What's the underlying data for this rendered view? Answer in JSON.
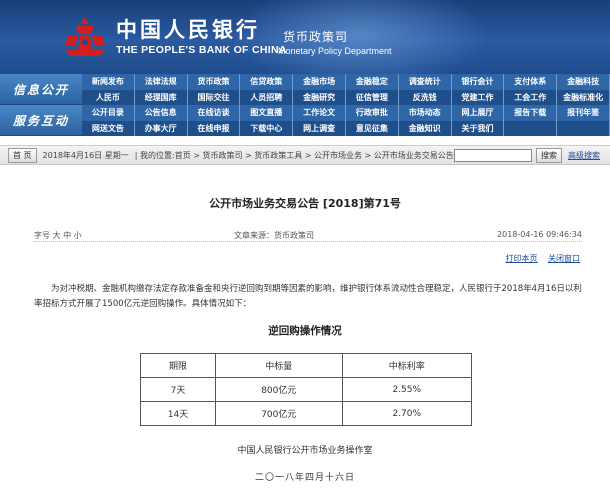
{
  "header": {
    "brand_cn": "中国人民银行",
    "brand_en": "THE PEOPLE'S BANK OF CHINA",
    "dept_cn": "货币政策司",
    "dept_en": "Monetary Policy Department"
  },
  "nav": {
    "rows": [
      {
        "side": "信息公开",
        "items": [
          "新闻发布",
          "法律法规",
          "货币政策",
          "信贷政策",
          "金融市场",
          "金融稳定",
          "调查统计",
          "银行会计",
          "支付体系",
          "金融科技",
          "人民币",
          "经理国库",
          "国际交往",
          "人员招聘",
          "金融研究",
          "征信管理",
          "反洗钱",
          "党建工作",
          "工会工作",
          "金融标准化"
        ]
      },
      {
        "side": "服务互动",
        "items": [
          "公开目录",
          "公告信息",
          "在线访谈",
          "图文直播",
          "工作论文",
          "行政审批",
          "市场动态",
          "网上展厅",
          "报告下载",
          "报刊年鉴",
          "网送文告",
          "办事大厅",
          "在线申报",
          "下载中心",
          "网上调查",
          "意见征集",
          "金融知识",
          "关于我们",
          "",
          ""
        ]
      }
    ]
  },
  "crumbbar": {
    "home_button": "首 页",
    "date": "2018年4月16日 星期一",
    "path": "| 我的位置:首页 > 货币政策司 > 货币政策工具 > 公开市场业务 > 公开市场业务交易公告",
    "search_button": "搜索",
    "advanced_search": "高级搜索"
  },
  "article": {
    "title": "公开市场业务交易公告 [2018]第71号",
    "font_size_label": "字号 大 中 小",
    "source": "文章来源：货币政策司",
    "datetime": "2018-04-16 09:46:34",
    "print_label": "打印本页",
    "close_label": "关闭窗口",
    "body": "为对冲税期、金融机构缴存法定存款准备金和央行逆回购到期等因素的影响，维护银行体系流动性合理稳定，人民银行于2018年4月16日以利率招标方式开展了1500亿元逆回购操作。具体情况如下：",
    "table_title": "逆回购操作情况",
    "table": {
      "headers": [
        "期限",
        "中标量",
        "中标利率"
      ],
      "rows": [
        [
          "7天",
          "800亿元",
          "2.55%"
        ],
        [
          "14天",
          "700亿元",
          "2.70%"
        ]
      ]
    },
    "signature": "中国人民银行公开市场业务操作室",
    "sign_date": "二〇一八年四月十六日"
  },
  "colors": {
    "header_blue": "#1f4c8e",
    "nav_blue": "#2e66a7",
    "emblem_red": "#d41f1f"
  }
}
